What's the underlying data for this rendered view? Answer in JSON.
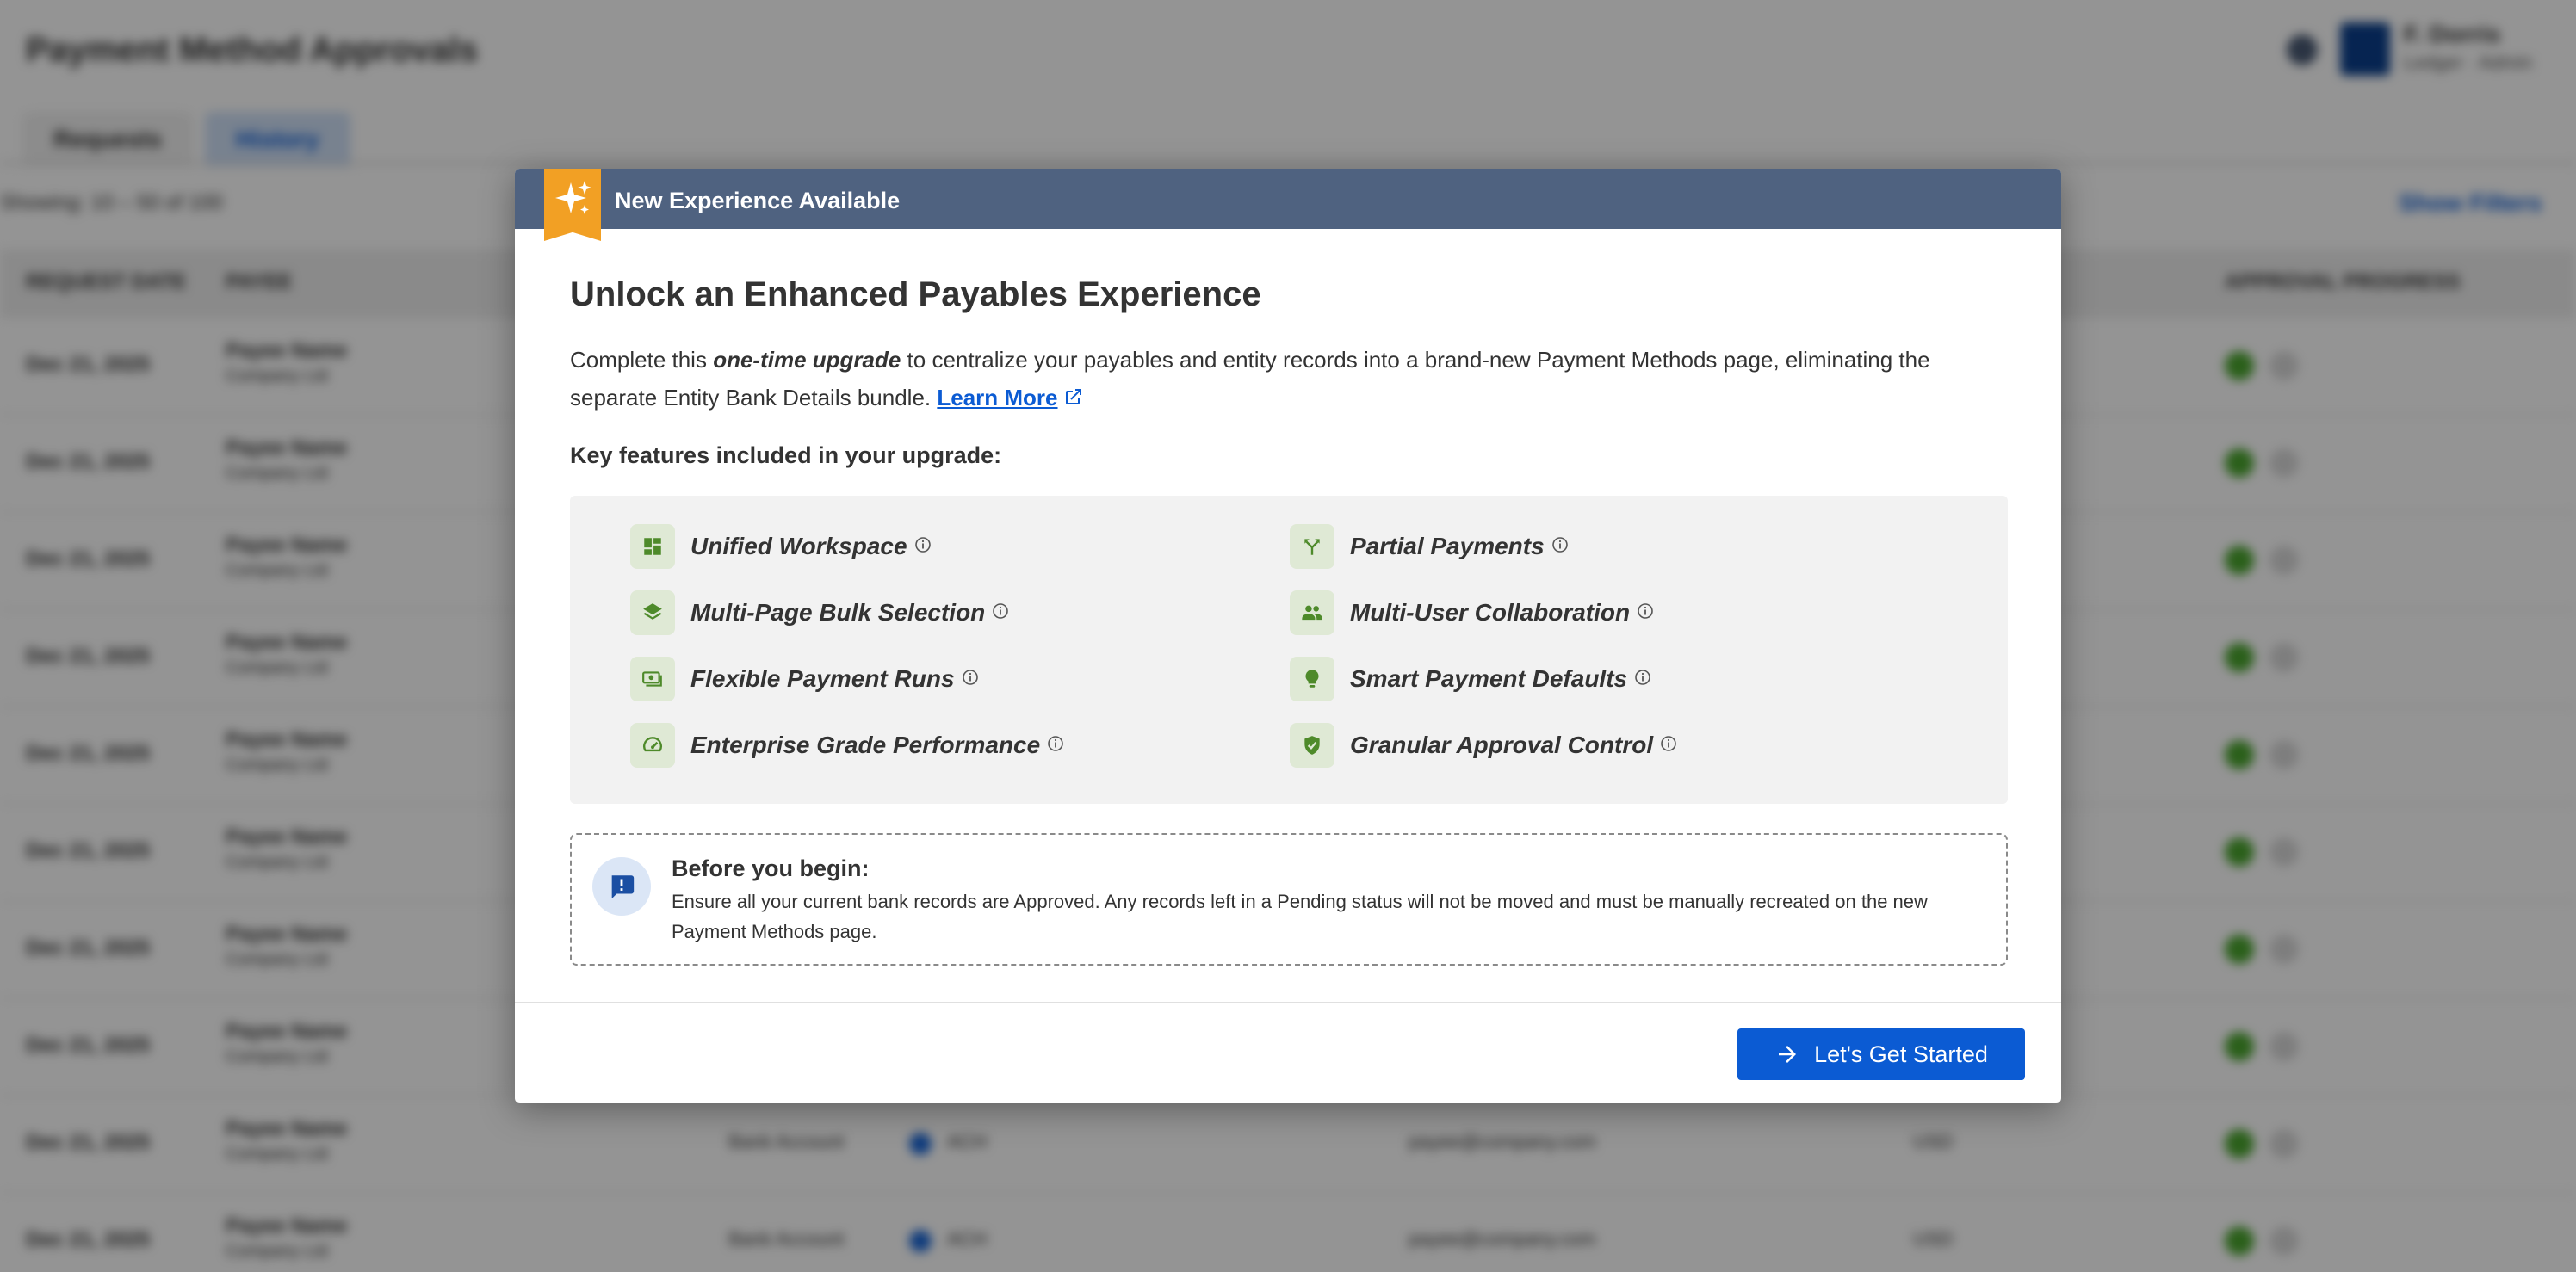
{
  "background": {
    "page_title": "Payment Method Approvals",
    "user_name": "F. Dorris",
    "user_sub": "Ledger · Admin",
    "tabs": [
      {
        "label": "Requests"
      },
      {
        "label": "History"
      }
    ],
    "toolbar_text": "Showing: 10 – 50 of 100",
    "toolbar_right": "Show Filters",
    "columns": [
      "REQUEST DATE",
      "PAYEE",
      "APPROVAL PROGRESS"
    ],
    "rows": [
      {
        "date": "Dec 21, 2025",
        "payee": "Payee Name",
        "payee_sub": "Company Ltd"
      },
      {
        "date": "Dec 21, 2025",
        "payee": "Payee Name",
        "payee_sub": "Company Ltd"
      },
      {
        "date": "Dec 21, 2025",
        "payee": "Payee Name",
        "payee_sub": "Company Ltd"
      },
      {
        "date": "Dec 21, 2025",
        "payee": "Payee Name",
        "payee_sub": "Company Ltd"
      },
      {
        "date": "Dec 21, 2025",
        "payee": "Payee Name",
        "payee_sub": "Company Ltd"
      },
      {
        "date": "Dec 21, 2025",
        "payee": "Payee Name",
        "payee_sub": "Company Ltd"
      },
      {
        "date": "Dec 21, 2025",
        "payee": "Payee Name",
        "payee_sub": "Company Ltd"
      },
      {
        "date": "Dec 21, 2025",
        "payee": "Payee Name",
        "payee_sub": "Company Ltd"
      },
      {
        "date": "Dec 21, 2025",
        "payee": "Payee Name",
        "payee_sub": "Company Ltd",
        "account": "Bank Account",
        "method": "ACH",
        "email": "payee@company.com",
        "currency": "USD"
      },
      {
        "date": "Dec 21, 2025",
        "payee": "Payee Name",
        "payee_sub": "Company Ltd",
        "account": "Bank Account",
        "method": "ACH",
        "email": "payee@company.com",
        "currency": "USD"
      }
    ]
  },
  "modal": {
    "header_title": "New Experience Available",
    "heading": "Unlock an Enhanced Payables Experience",
    "desc_prefix": "Complete this ",
    "desc_emphasis": "one-time upgrade",
    "desc_suffix": " to centralize your payables and entity records into a brand-new Payment Methods page, eliminating the separate Entity Bank Details bundle. ",
    "learn_more": "Learn More",
    "features_heading": "Key features included in your upgrade:",
    "features": [
      {
        "label": "Unified Workspace",
        "icon": "dashboard-icon"
      },
      {
        "label": "Partial Payments",
        "icon": "split-icon"
      },
      {
        "label": "Multi-Page Bulk Selection",
        "icon": "layers-icon"
      },
      {
        "label": "Multi-User Collaboration",
        "icon": "people-icon"
      },
      {
        "label": "Flexible Payment Runs",
        "icon": "payments-icon"
      },
      {
        "label": "Smart Payment Defaults",
        "icon": "lightbulb-icon"
      },
      {
        "label": "Enterprise Grade Performance",
        "icon": "speed-icon"
      },
      {
        "label": "Granular Approval Control",
        "icon": "shield-check-icon"
      }
    ],
    "before_title": "Before you begin:",
    "before_text": "Ensure all your current bank records are Approved. Any records left in a Pending status will not be moved and must be manually recreated on the new Payment Methods page.",
    "cta_label": "Let's Get Started"
  },
  "colors": {
    "header_bg": "#4f6280",
    "ribbon": "#f2a024",
    "accent_blue": "#0b5bd3",
    "feature_green": "#4e8a2a",
    "feature_icon_bg": "#dfe9d5"
  }
}
